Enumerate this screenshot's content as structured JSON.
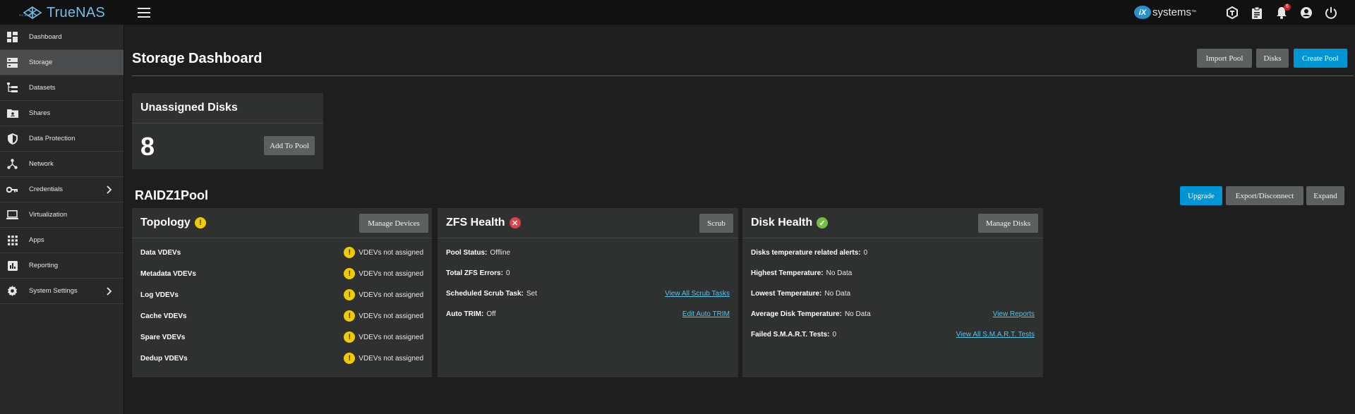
{
  "topbar": {
    "logo_text": "TrueNAS",
    "logo_sub": "SCALE",
    "ix_text": "systems",
    "ix_mark": "iX",
    "ix_sup": "™",
    "notification_count": "6",
    "icons": [
      "truecommand-icon",
      "clipboard-icon",
      "bell-icon",
      "account-icon",
      "power-icon"
    ]
  },
  "sidebar": {
    "items": [
      {
        "label": "Dashboard",
        "icon": "dashboard-icon"
      },
      {
        "label": "Storage",
        "icon": "storage-icon",
        "active": true
      },
      {
        "label": "Datasets",
        "icon": "datasets-icon"
      },
      {
        "label": "Shares",
        "icon": "shares-icon"
      },
      {
        "label": "Data Protection",
        "icon": "shield-icon"
      },
      {
        "label": "Network",
        "icon": "network-icon"
      },
      {
        "label": "Credentials",
        "icon": "key-icon",
        "has_submenu": true
      },
      {
        "label": "Virtualization",
        "icon": "laptop-icon"
      },
      {
        "label": "Apps",
        "icon": "apps-icon"
      },
      {
        "label": "Reporting",
        "icon": "reporting-icon"
      },
      {
        "label": "System Settings",
        "icon": "gear-icon",
        "has_submenu": true
      }
    ]
  },
  "page": {
    "title": "Storage Dashboard",
    "buttons": {
      "import_pool": "Import Pool",
      "disks": "Disks",
      "create_pool": "Create Pool"
    }
  },
  "unassigned": {
    "title": "Unassigned Disks",
    "count": "8",
    "add_button": "Add To Pool"
  },
  "pool": {
    "name": "RAIDZ1Pool",
    "buttons": {
      "upgrade": "Upgrade",
      "export": "Export/Disconnect",
      "expand": "Expand"
    },
    "topology": {
      "title": "Topology",
      "status": "warning",
      "manage_button": "Manage Devices",
      "rows": [
        {
          "label": "Data VDEVs",
          "value": "VDEVs not assigned"
        },
        {
          "label": "Metadata VDEVs",
          "value": "VDEVs not assigned"
        },
        {
          "label": "Log VDEVs",
          "value": "VDEVs not assigned"
        },
        {
          "label": "Cache VDEVs",
          "value": "VDEVs not assigned"
        },
        {
          "label": "Spare VDEVs",
          "value": "VDEVs not assigned"
        },
        {
          "label": "Dedup VDEVs",
          "value": "VDEVs not assigned"
        }
      ]
    },
    "zfs_health": {
      "title": "ZFS Health",
      "status": "error",
      "scrub_button": "Scrub",
      "rows": [
        {
          "label": "Pool Status:",
          "value": "Offline"
        },
        {
          "label": "Total ZFS Errors:",
          "value": "0"
        },
        {
          "label": "Scheduled Scrub Task:",
          "value": "Set",
          "link": "View All Scrub Tasks"
        },
        {
          "label": "Auto TRIM:",
          "value": "Off",
          "link": "Edit Auto TRIM"
        }
      ]
    },
    "disk_health": {
      "title": "Disk Health",
      "status": "ok",
      "manage_button": "Manage Disks",
      "rows": [
        {
          "label": "Disks temperature related alerts:",
          "value": "0"
        },
        {
          "label": "Highest Temperature:",
          "value": "No Data"
        },
        {
          "label": "Lowest Temperature:",
          "value": "No Data"
        },
        {
          "label": "Average Disk Temperature:",
          "value": "No Data",
          "link": "View Reports"
        },
        {
          "label": "Failed S.M.A.R.T. Tests:",
          "value": "0",
          "link": "View All S.M.A.R.T. Tests"
        }
      ]
    }
  },
  "colors": {
    "accent": "#0095d5",
    "link": "#57c4e8",
    "warning": "#f0cb00",
    "error": "#e24047",
    "ok": "#71bf44",
    "logo": "#71bfe6"
  }
}
